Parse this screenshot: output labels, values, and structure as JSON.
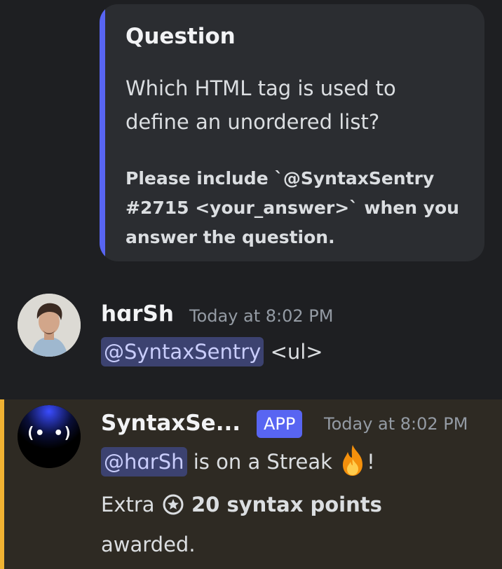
{
  "embed": {
    "title": "Question",
    "description": "Which HTML tag is used to define an unordered list?",
    "note": "Please include `@SyntaxSentry #2715 <your_answer>` when you answer the question.",
    "accent_color": "#5865f2"
  },
  "messages": [
    {
      "username": "hɑrSh",
      "timestamp": "Today at 8:02 PM",
      "mention": "@SyntaxSentry",
      "text": "<ul>"
    },
    {
      "username": "SyntaxSe...",
      "badge": "APP",
      "timestamp": "Today at 8:02 PM",
      "mention": "@hɑrSh",
      "line1_text": "is on a Streak",
      "line1_end": "!",
      "line2_prefix": "Extra",
      "line2_bold": "20 syntax points",
      "line3": "awarded.",
      "bot_face": "(• •)",
      "highlight_color": "#f0b232"
    }
  ]
}
